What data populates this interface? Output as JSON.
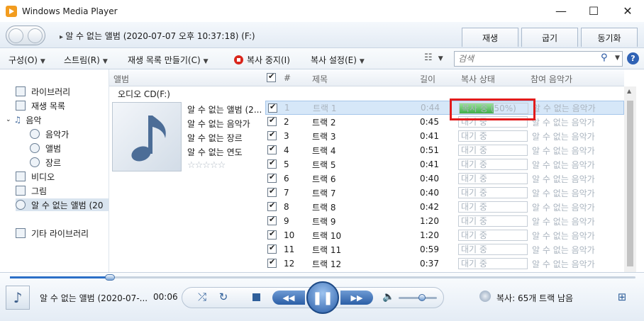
{
  "window": {
    "title": "Windows Media Player"
  },
  "nav": {
    "breadcrumb": "알 수 없는 앨범 (2020-07-07 오후 10:37:18) (F:)"
  },
  "tabs": [
    "재생",
    "굽기",
    "동기화"
  ],
  "toolbar": {
    "organize": "구성(O)",
    "stream": "스트림(R)",
    "create_playlist": "재생 목록 만들기(C)",
    "stop_rip": "복사 중지(I)",
    "rip_settings": "복사 설정(E)",
    "search_placeholder": "검색"
  },
  "sidebar": {
    "items": [
      "라이브러리",
      "재생 목록",
      "음악",
      "음악가",
      "앨범",
      "장르",
      "비디오",
      "그림",
      "알 수 없는 앨범 (20",
      "기타 라이브러리"
    ]
  },
  "columns": {
    "album": "앨범",
    "number": "#",
    "title": "제목",
    "length": "길이",
    "rip_status": "복사 상태",
    "contributing_artist": "참여 음악가"
  },
  "album_group": {
    "header": "오디오 CD(F:)",
    "title": "알 수 없는 앨범 (2...",
    "artist": "알 수 없는 음악가",
    "genre": "알 수 없는 장르",
    "year": "알 수 없는 연도"
  },
  "tracks": [
    {
      "num": "1",
      "title": "트랙 1",
      "length": "0:44",
      "status": "복사 중 (50%)",
      "progress": 0.5,
      "artist": "알 수 없는 음악가"
    },
    {
      "num": "2",
      "title": "트랙 2",
      "length": "0:45",
      "status": "대기 중",
      "artist": "알 수 없는 음악가"
    },
    {
      "num": "3",
      "title": "트랙 3",
      "length": "0:41",
      "status": "대기 중",
      "artist": "알 수 없는 음악가"
    },
    {
      "num": "4",
      "title": "트랙 4",
      "length": "0:51",
      "status": "대기 중",
      "artist": "알 수 없는 음악가"
    },
    {
      "num": "5",
      "title": "트랙 5",
      "length": "0:41",
      "status": "대기 중",
      "artist": "알 수 없는 음악가"
    },
    {
      "num": "6",
      "title": "트랙 6",
      "length": "0:40",
      "status": "대기 중",
      "artist": "알 수 없는 음악가"
    },
    {
      "num": "7",
      "title": "트랙 7",
      "length": "0:40",
      "status": "대기 중",
      "artist": "알 수 없는 음악가"
    },
    {
      "num": "8",
      "title": "트랙 8",
      "length": "0:42",
      "status": "대기 중",
      "artist": "알 수 없는 음악가"
    },
    {
      "num": "9",
      "title": "트랙 9",
      "length": "1:20",
      "status": "대기 중",
      "artist": "알 수 없는 음악가"
    },
    {
      "num": "10",
      "title": "트랙 10",
      "length": "1:20",
      "status": "대기 중",
      "artist": "알 수 없는 음악가"
    },
    {
      "num": "11",
      "title": "트랙 11",
      "length": "0:59",
      "status": "대기 중",
      "artist": "알 수 없는 음악가"
    },
    {
      "num": "12",
      "title": "트랙 12",
      "length": "0:37",
      "status": "대기 중",
      "artist": "알 수 없는 음악가"
    }
  ],
  "player": {
    "now_playing": "알 수 없는 앨범 (2020-07-...",
    "time": "00:06",
    "rip_status": "복사: 65개 트랙 남음",
    "seek_fraction": 0.16
  },
  "colors": {
    "accent": "#2b6fc7",
    "highlight_frame": "#e21b1b",
    "progress_fill": "#3fae49"
  }
}
